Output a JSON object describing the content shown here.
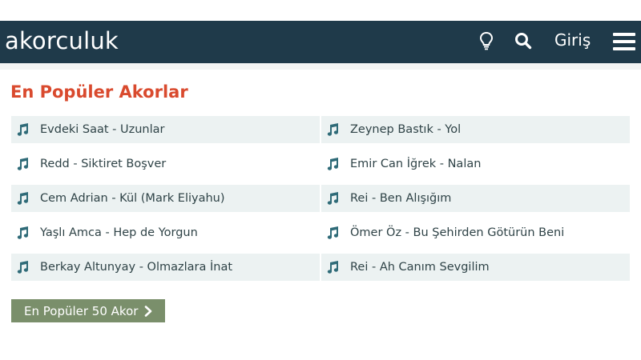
{
  "header": {
    "brand": "akorculuk",
    "login_label": "Giriş",
    "icons": [
      "lightbulb-icon",
      "search-icon",
      "hamburger-menu-icon"
    ]
  },
  "section": {
    "title": "En Popüler Akorlar"
  },
  "songs_left": [
    {
      "label": "Evdeki Saat - Uzunlar"
    },
    {
      "label": "Redd - Siktiret Boşver"
    },
    {
      "label": "Cem Adrian - Kül (Mark Eliyahu)"
    },
    {
      "label": "Yaşlı Amca - Hep de Yorgun"
    },
    {
      "label": "Berkay Altunyay - Olmazlara İnat"
    }
  ],
  "songs_right": [
    {
      "label": "Zeynep Bastık - Yol"
    },
    {
      "label": "Emir Can İğrek - Nalan"
    },
    {
      "label": "Rei - Ben Alışığım"
    },
    {
      "label": "Ömer Öz - Bu Şehirden Götürün Beni"
    },
    {
      "label": "Rei - Ah Canım Sevgilim"
    }
  ],
  "more_button": {
    "label": "En Popüler 50 Akor"
  },
  "colors": {
    "navbar": "#1f3a4a",
    "title": "#d94a2e",
    "row_shade": "#ecf2f2",
    "button": "#7a8f6b"
  }
}
